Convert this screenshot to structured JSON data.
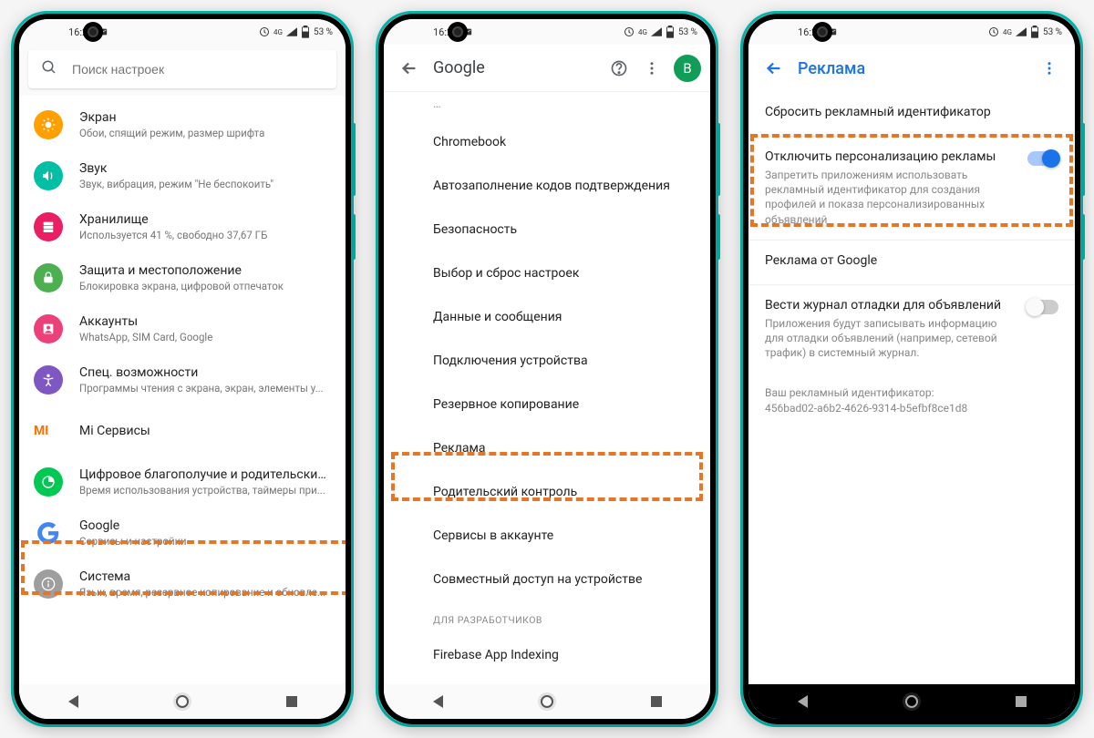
{
  "status": {
    "time": "16:27",
    "network": "4G",
    "battery": "53 %"
  },
  "phone1": {
    "search_placeholder": "Поиск настроек",
    "items": [
      {
        "title": "Экран",
        "sub": "Обои, спящий режим, размер шрифта"
      },
      {
        "title": "Звук",
        "sub": "Звук, вибрация, режим \"Не беспокоить\""
      },
      {
        "title": "Хранилище",
        "sub": "Используется 41 %, свободно 37,67 ГБ"
      },
      {
        "title": "Защита и местоположение",
        "sub": "Блокировка экрана, цифровой отпечаток"
      },
      {
        "title": "Аккаунты",
        "sub": "WhatsApp, SIM Card, Google"
      },
      {
        "title": "Спец. возможности",
        "sub": "Программы чтения с экрана, экран, элементы у..."
      },
      {
        "title": "Mi Сервисы",
        "sub": ""
      },
      {
        "title": "Цифровое благополучие и родительский кон...",
        "sub": "Время использования устройства, таймеры при..."
      },
      {
        "title": "Google",
        "sub": "Сервисы и настройки"
      },
      {
        "title": "Система",
        "sub": "Язык, время, резервное копирование и обновле..."
      }
    ]
  },
  "phone2": {
    "title": "Google",
    "avatar_letter": "B",
    "items": [
      "Chromebook",
      "Автозаполнение кодов подтверждения",
      "Безопасность",
      "Выбор и сброс настроек",
      "Данные и сообщения",
      "Подключения устройства",
      "Резервное копирование",
      "Реклама",
      "Родительский контроль",
      "Сервисы в аккаунте",
      "Совместный доступ на устройстве"
    ],
    "section_dev": "ДЛЯ РАЗРАБОТЧИКОВ",
    "dev_item": "Firebase App Indexing"
  },
  "phone3": {
    "title": "Реклама",
    "rows": {
      "reset": "Сбросить рекламный идентификатор",
      "optout_title": "Отключить персонализацию рекламы",
      "optout_sub": "Запретить приложениям использовать рекламный идентификатор для создания профилей и показа персонализированных объявлений",
      "ads_by_google": "Реклама от Google",
      "debug_title": "Вести журнал отладки для объявлений",
      "debug_sub": "Приложения будут записывать информацию для отладки объявлений (например, сетевой трафик) в системный журнал.",
      "ad_id_label": "Ваш рекламный идентификатор:",
      "ad_id_value": "456bad02-a6b2-4626-9314-b5efbf8ce1d8"
    }
  }
}
